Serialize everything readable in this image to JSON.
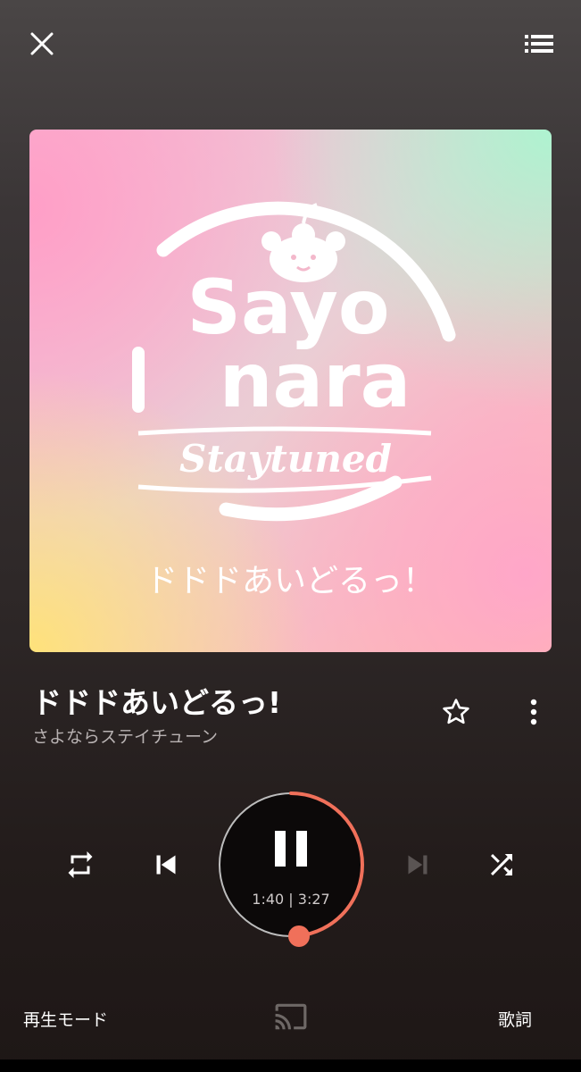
{
  "header": {
    "close_icon": "close-icon",
    "queue_icon": "queue-list-icon"
  },
  "album_art": {
    "line1": "Sayo",
    "line2": "nara",
    "line3": "Staytuned",
    "bottom_text": "ドドドあいどるっ！"
  },
  "track": {
    "title": "ドドドあいどるっ!",
    "artist": "さよならステイチューン",
    "elapsed": "1:40",
    "duration": "3:27",
    "time_display": "1:40 | 3:27",
    "progress_fraction": 0.483
  },
  "colors": {
    "accent": "#f0705a",
    "ring_track": "#bdbdbd"
  },
  "controls": {
    "repeat_icon": "repeat-icon",
    "previous_icon": "skip-previous-icon",
    "play_pause_icon": "pause-icon",
    "next_icon": "skip-next-icon",
    "shuffle_icon": "shuffle-icon",
    "favorite_icon": "star-outline-icon",
    "more_icon": "more-vertical-icon"
  },
  "footer": {
    "play_mode_label": "再生モード",
    "cast_icon": "cast-icon",
    "lyrics_label": "歌詞"
  }
}
